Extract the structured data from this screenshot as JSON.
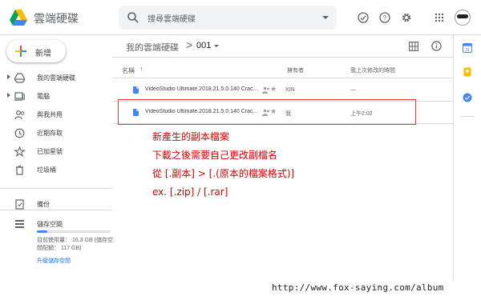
{
  "header": {
    "app_title": "雲端硬碟",
    "search_placeholder": "搜尋雲端硬碟"
  },
  "sidebar": {
    "new_label": "新增",
    "items": [
      {
        "label": "我的雲端硬碟",
        "icon": "drive-icon",
        "expandable": true
      },
      {
        "label": "電腦",
        "icon": "computer-icon",
        "expandable": true
      },
      {
        "label": "與我共用",
        "icon": "shared-with-me-icon",
        "expandable": false
      },
      {
        "label": "近期存取",
        "icon": "clock-icon",
        "expandable": false
      },
      {
        "label": "已加星號",
        "icon": "star-icon",
        "expandable": false
      },
      {
        "label": "垃圾桶",
        "icon": "trash-icon",
        "expandable": false
      },
      {
        "label": "備份",
        "icon": "backup-icon",
        "expandable": false
      }
    ],
    "storage": {
      "title": "儲存空間",
      "used_fraction": 0.14,
      "usage_text": "目前使用量： 16.3 GB (儲存空間配額： 117 GB)",
      "upgrade_label": "升級儲存空間"
    }
  },
  "breadcrumb": {
    "root": "我的雲端硬碟",
    "separator": ">",
    "current": "001"
  },
  "columns": {
    "name": "名稱",
    "sort_arrow": "↑",
    "owner": "擁有者",
    "modified": "我上次修改的時間"
  },
  "files": [
    {
      "name": "VideoStudio Ultimate.2018.21.5.0.140 Crack.zip",
      "owner": "XIN",
      "modified": "—",
      "shared": true
    },
    {
      "name": "VideoStudio Ultimate.2018.21.5.0.140 Crack.zip",
      "owner": "我",
      "modified": "上午2:02",
      "shared": true
    }
  ],
  "annotation": {
    "line1": "新產生的副本檔案",
    "line2": "下載之後需要自己更改副檔名",
    "line3": "從 [.副本] > [.(原本的檔案格式)]",
    "line4": "ex. [.zip] / [.rar]",
    "color": "#d50000"
  },
  "watermark": "http://www.fox-saying.com/album",
  "colors": {
    "accent": "#1a73e8",
    "highlight_border": "#e53935"
  }
}
